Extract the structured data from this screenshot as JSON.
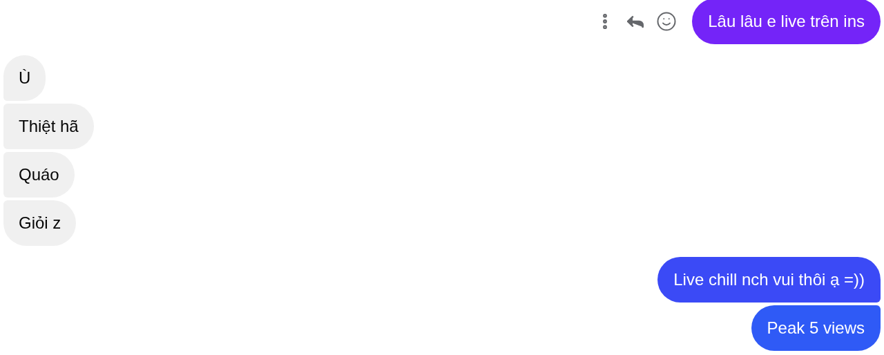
{
  "messages": [
    {
      "kind": "sent",
      "text": "Lâu lâu e live trên ins",
      "color": "#7424f8",
      "hovered": true
    },
    {
      "kind": "received",
      "text": "Ù"
    },
    {
      "kind": "received",
      "text": "Thiệt hã"
    },
    {
      "kind": "received",
      "text": "Quáo"
    },
    {
      "kind": "received",
      "text": "Giỏi z"
    },
    {
      "kind": "sent",
      "text": "Live chill nch vui thôi ạ =))",
      "color": "#3b4af6"
    },
    {
      "kind": "sent",
      "text": "Peak 5 views",
      "color": "#2f5af6"
    }
  ]
}
